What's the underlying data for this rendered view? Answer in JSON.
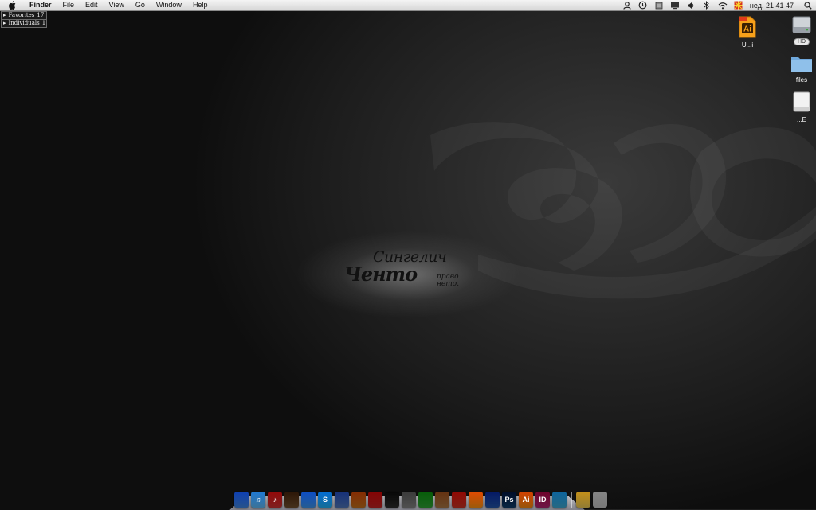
{
  "menubar": {
    "app_name": "Finder",
    "menus": [
      "File",
      "Edit",
      "View",
      "Go",
      "Window",
      "Help"
    ],
    "clock": "нед. 21 41 47"
  },
  "favorites": [
    {
      "label": "Favorites",
      "count": "17"
    },
    {
      "label": "Individuals",
      "count": "1"
    }
  ],
  "wallpaper": {
    "line1": "Сингелич",
    "line2": "Ченто",
    "tagline": "право нето."
  },
  "desktop_icons": [
    {
      "label": "U...i",
      "icon": "illustrator-file-icon"
    },
    {
      "label": "HD",
      "icon": "hard-drive-icon"
    },
    {
      "label": "files",
      "icon": "folder-icon"
    },
    {
      "label": "...E",
      "icon": "external-drive-icon"
    }
  ],
  "dock": {
    "items": [
      {
        "name": "finder",
        "glyph": "",
        "color": "#3c7fd6"
      },
      {
        "name": "itunes",
        "glyph": "♫",
        "color": "#5ab0e8"
      },
      {
        "name": "music-app",
        "glyph": "♪",
        "color": "#c23030"
      },
      {
        "name": "preview",
        "glyph": "",
        "color": "#6a4a2a"
      },
      {
        "name": "safari",
        "glyph": "",
        "color": "#3a8de0"
      },
      {
        "name": "skype",
        "glyph": "S",
        "color": "#1ea7e8"
      },
      {
        "name": "mail",
        "glyph": "",
        "color": "#4a6fb0"
      },
      {
        "name": "garageband",
        "glyph": "",
        "color": "#b86a1a"
      },
      {
        "name": "app-red",
        "glyph": "",
        "color": "#b82020"
      },
      {
        "name": "app-dark",
        "glyph": "",
        "color": "#2a2a2a"
      },
      {
        "name": "app-grey",
        "glyph": "",
        "color": "#7a7a7a"
      },
      {
        "name": "app-green",
        "glyph": "",
        "color": "#2a9a30"
      },
      {
        "name": "app-photo",
        "glyph": "",
        "color": "#a07040"
      },
      {
        "name": "app-red2",
        "glyph": "",
        "color": "#c03020"
      },
      {
        "name": "vlc",
        "glyph": "",
        "color": "#f08a10"
      },
      {
        "name": "app-blue",
        "glyph": "",
        "color": "#2050a0"
      },
      {
        "name": "photoshop",
        "glyph": "Ps",
        "color": "#0d3a66"
      },
      {
        "name": "illustrator",
        "glyph": "Ai",
        "color": "#e8820e"
      },
      {
        "name": "indesign",
        "glyph": "ID",
        "color": "#a8206a"
      },
      {
        "name": "app-rainbow",
        "glyph": "",
        "color": "#3aa0c8"
      }
    ],
    "right_items": [
      {
        "name": "stack",
        "glyph": "",
        "color": "#e0c050"
      },
      {
        "name": "trash",
        "glyph": "",
        "color": "#b8b8b8"
      }
    ]
  }
}
